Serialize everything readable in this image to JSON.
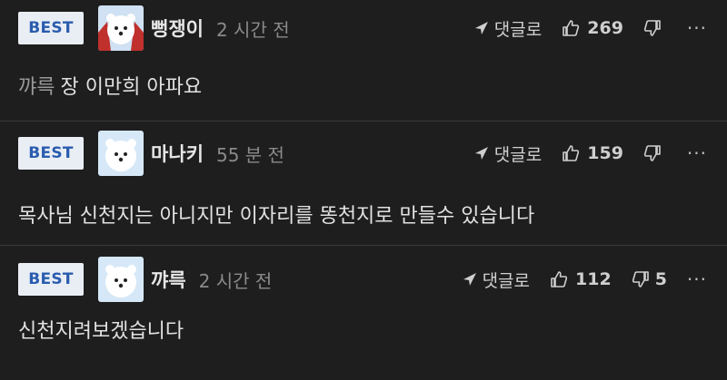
{
  "badge_label": "BEST",
  "reply_label": "댓글로",
  "more_label": "···",
  "comments": [
    {
      "nickname": "뻥쟁이",
      "time": "2 시간 전",
      "likes": "269",
      "dislikes": "",
      "mention": "꺄륵",
      "text": "장 이만희 아파요"
    },
    {
      "nickname": "마나키",
      "time": "55 분 전",
      "likes": "159",
      "dislikes": "",
      "mention": "",
      "text": "목사님 신천지는 아니지만 이자리를 똥천지로 만들수 있습니다"
    },
    {
      "nickname": "꺄륵",
      "time": "2 시간 전",
      "likes": "112",
      "dislikes": "5",
      "mention": "",
      "text": "신천지려보겠습니다"
    }
  ]
}
